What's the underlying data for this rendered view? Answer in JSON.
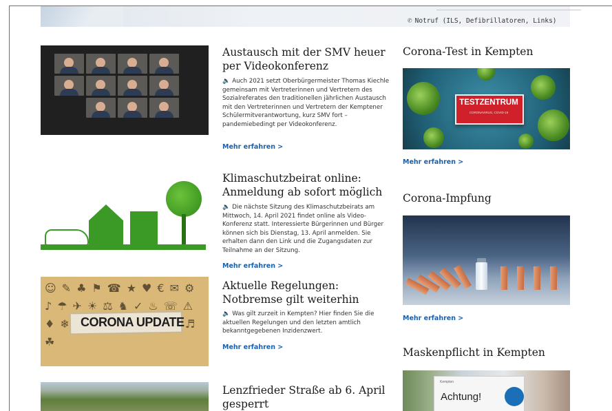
{
  "top": {
    "notruf_text": "Notruf (ILS, Defibrillatoren, Links)",
    "phone_icon": "phone-icon"
  },
  "articles": [
    {
      "title": "Austausch mit der SMV heuer per Videokonferenz",
      "text": "Auch 2021 setzt Oberbürgermeister Thomas Kiechle gemeinsam mit Vertreterinnen und Vertretern des Sozialreferates den traditionellen jährlichen Austausch mit den Vertreterinnen und Vertretern der Kemptener Schülermitverantwortung, kurz SMV fort – pandemiebedingt per Videokonferenz.",
      "more": "Mehr erfahren >"
    },
    {
      "title": "Klimaschutzbeirat online: Anmeldung ab sofort möglich",
      "text": "Die nächste Sitzung des Klimaschutzbeirats am Mittwoch, 14. April 2021 findet online als Video-Konferenz statt. Interessierte Bürgerinnen und Bürger können sich bis Dienstag, 13. April anmelden. Sie erhalten dann den Link und die Zugangsdaten zur Teilnahme an der Sitzung.",
      "more": "Mehr erfahren >"
    },
    {
      "title": "Aktuelle Regelungen: Notbremse gilt weiterhin",
      "text": "Was gilt zurzeit in Kempten? Hier finden Sie die aktuellen Regelungen und den letzten amtlich bekanntgegebenen Inzidenzwert.",
      "more": "Mehr erfahren >",
      "image_label": "CORONA UPDATE"
    },
    {
      "title": "Lenzfrieder Straße ab 6. April gesperrt"
    }
  ],
  "sidebar": [
    {
      "title": "Corona-Test in Kempten",
      "more": "Mehr erfahren >",
      "image_sign": "TESTZENTRUM",
      "image_sign_sub": "CORONAVIRUS, COVID-19"
    },
    {
      "title": "Corona-Impfung",
      "more": "Mehr erfahren >"
    },
    {
      "title": "Maskenpflicht in Kempten",
      "image_small": "Kempten",
      "image_text": "Achtung!"
    }
  ],
  "colors": {
    "link": "#1b5fa8",
    "title": "#1a1a1a"
  }
}
